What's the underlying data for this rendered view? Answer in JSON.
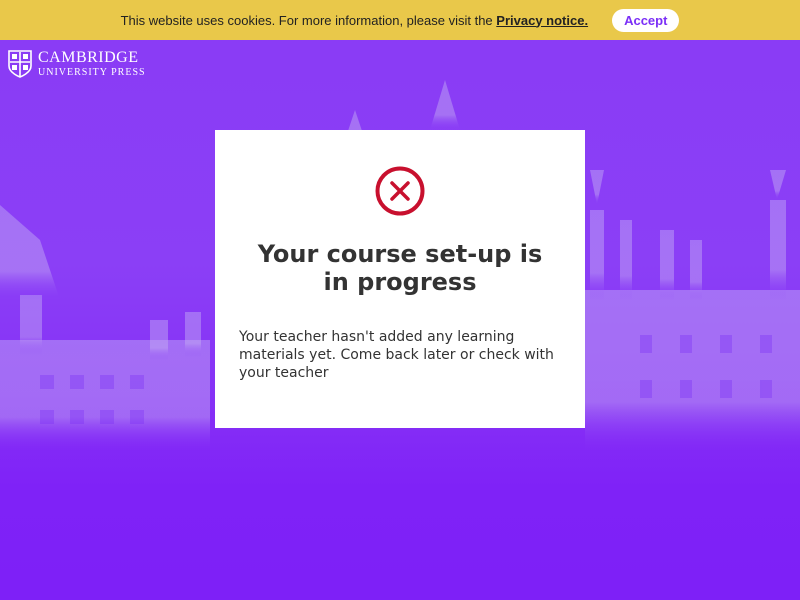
{
  "cookie_banner": {
    "text": "This website uses cookies. For more information, please visit the",
    "link_label": "Privacy notice.",
    "accept_label": "Accept"
  },
  "logo": {
    "line1": "CAMBRIDGE",
    "line2": "UNIVERSITY PRESS"
  },
  "modal": {
    "icon": "error-circle-x-icon",
    "title": "Your course set-up is in progress",
    "message": "Your teacher hasn't added any learning materials yet. Come back later or check with your teacher"
  },
  "colors": {
    "banner": "#e9c84a",
    "background": "#7f2cf6",
    "accent": "#7b2ff7",
    "error": "#c8102e"
  }
}
